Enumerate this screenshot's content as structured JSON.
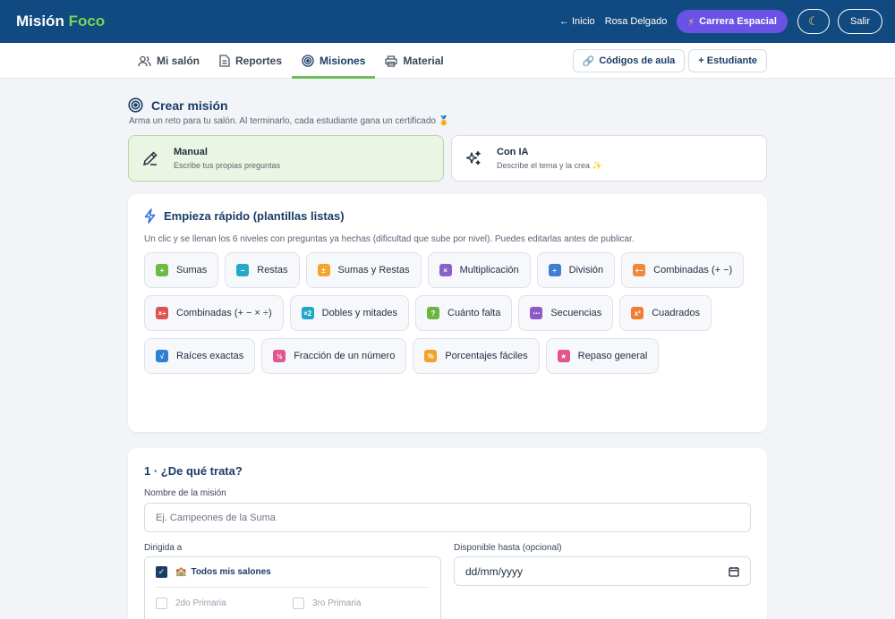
{
  "header": {
    "brand_main": "Misión",
    "brand_accent": "Foco",
    "home_link": "← Inicio",
    "user_name": "Rosa Delgado",
    "race_button": "Carrera Espacial",
    "logout_button": "Salir"
  },
  "nav": {
    "tabs": [
      {
        "label": "Mi salón",
        "icon": "users-icon"
      },
      {
        "label": "Reportes",
        "icon": "document-icon"
      },
      {
        "label": "Misiones",
        "icon": "target-icon",
        "active": true
      },
      {
        "label": "Material",
        "icon": "printer-icon"
      }
    ],
    "codes_button": "Códigos de aula",
    "add_student_button": "+ Estudiante"
  },
  "create": {
    "title": "Crear misión",
    "subtitle": "Arma un reto para tu salón. Al terminarlo, cada estudiante gana un certificado 🏅",
    "modes": [
      {
        "title": "Manual",
        "desc": "Escribe tus propias preguntas",
        "selected": true
      },
      {
        "title": "Con IA",
        "desc": "Describe el tema y la crea ✨",
        "selected": false
      }
    ]
  },
  "quick": {
    "title": "Empieza rápido (plantillas listas)",
    "subtitle": "Un clic y se llenan los 6 niveles con preguntas ya hechas (dificultad que sube por nivel). Puedes editarlas antes de publicar.",
    "templates": [
      {
        "label": "Sumas",
        "symbol": "+",
        "color": "#6dba45"
      },
      {
        "label": "Restas",
        "symbol": "−",
        "color": "#25a8c9"
      },
      {
        "label": "Sumas y Restas",
        "symbol": "±",
        "color": "#f3a62a"
      },
      {
        "label": "Multiplicación",
        "symbol": "×",
        "color": "#8a63c9"
      },
      {
        "label": "División",
        "symbol": "÷",
        "color": "#3f7fd0"
      },
      {
        "label": "Combinadas (+ −)",
        "symbol": "+−",
        "color": "#f0883a"
      },
      {
        "label": "Combinadas (+ − × ÷)",
        "symbol": "×÷",
        "color": "#e0514f"
      },
      {
        "label": "Dobles y mitades",
        "symbol": "×2",
        "color": "#1fa7c4"
      },
      {
        "label": "Cuánto falta",
        "symbol": "?",
        "color": "#6db540"
      },
      {
        "label": "Secuencias",
        "symbol": "⋯",
        "color": "#8c5ac8"
      },
      {
        "label": "Cuadrados",
        "symbol": "x²",
        "color": "#ef7d32"
      },
      {
        "label": "Raíces exactas",
        "symbol": "√",
        "color": "#2f7fd2"
      },
      {
        "label": "Fracción de un número",
        "symbol": "½",
        "color": "#e2558d"
      },
      {
        "label": "Porcentajes fáciles",
        "symbol": "%",
        "color": "#f2a12b"
      },
      {
        "label": "Repaso general",
        "symbol": "★",
        "color": "#e2558d"
      }
    ]
  },
  "form": {
    "step_title": "1 · ¿De qué trata?",
    "name_label": "Nombre de la misión",
    "name_placeholder": "Ej. Campeones de la Suma",
    "target_label": "Dirigida a",
    "all_salons": "Todos mis salones",
    "salons": [
      "2do Primaria",
      "3ro Primaria"
    ],
    "date_label": "Disponible hasta (opcional)",
    "date_placeholder": "dd/mm/yyyy"
  }
}
